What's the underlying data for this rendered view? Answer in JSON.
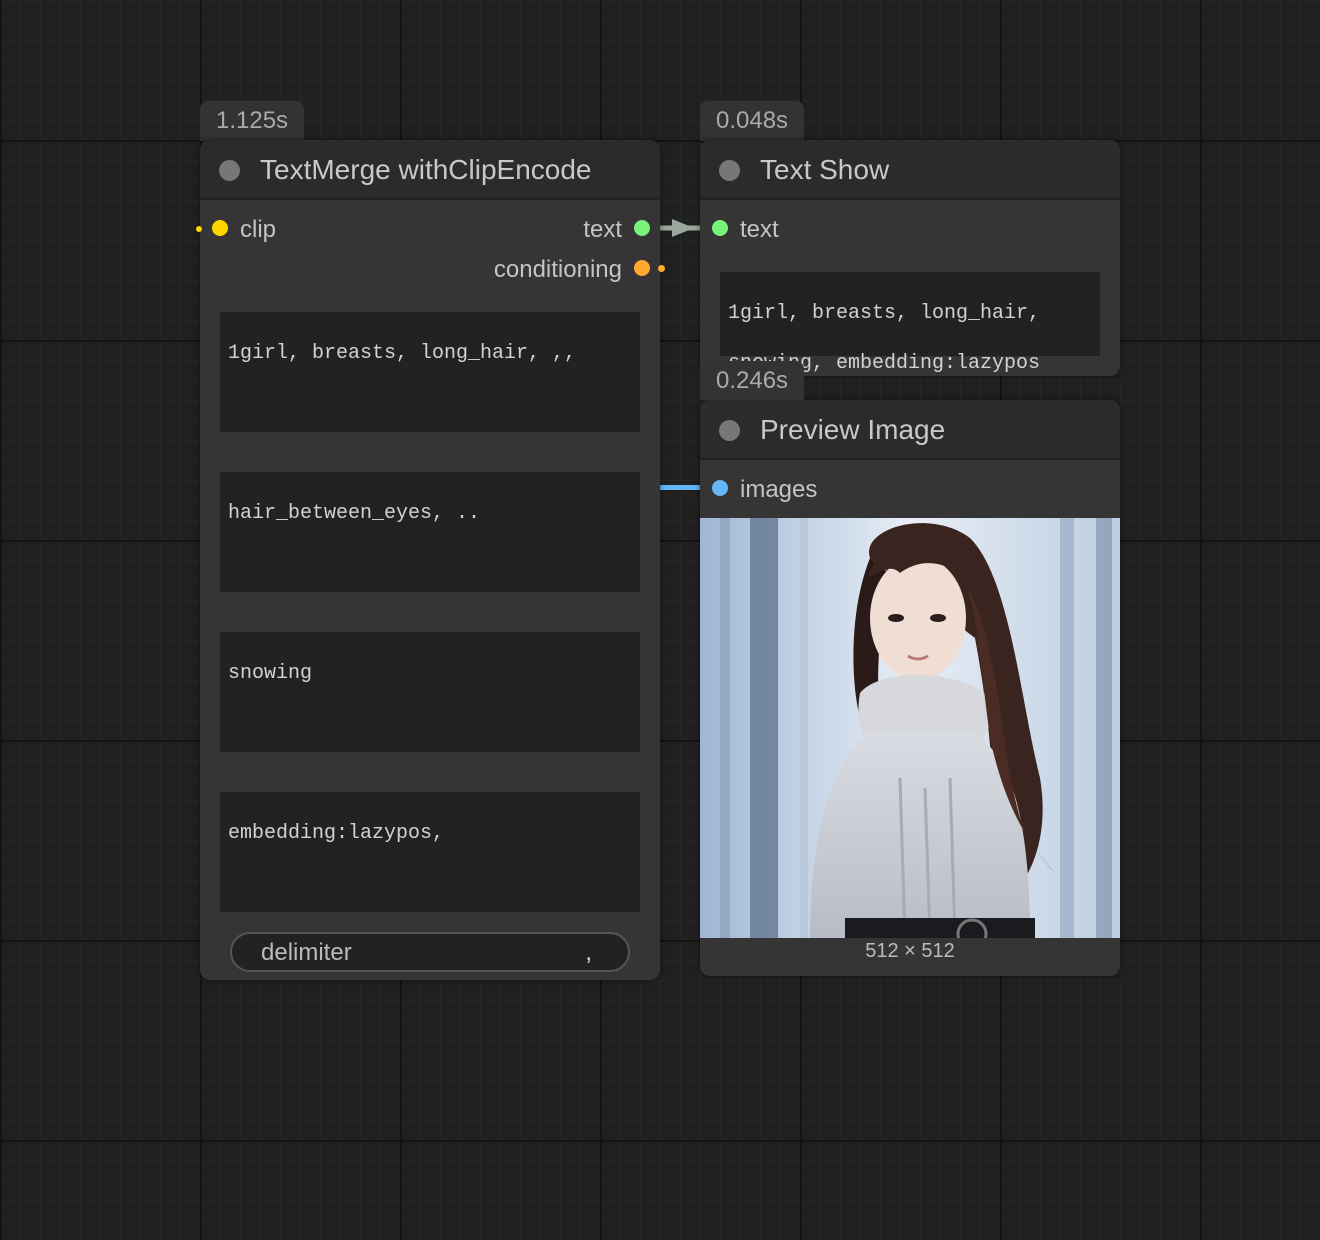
{
  "nodes": {
    "text_merge": {
      "timing": "1.125s",
      "title": "TextMerge withClipEncode",
      "inputs": [
        "clip"
      ],
      "outputs": [
        "text",
        "conditioning"
      ],
      "text_fields": [
        "1girl, breasts, long_hair, ,,",
        "hair_between_eyes, ..",
        "snowing",
        "embedding:lazypos,"
      ],
      "delimiter": {
        "name": "delimiter",
        "value": ","
      }
    },
    "text_show": {
      "timing": "0.048s",
      "title": "Text Show",
      "inputs": [
        "text"
      ],
      "display_text": "1girl, breasts, long_hair,",
      "overflow_text": "snowing, embedding:lazypos"
    },
    "preview_image": {
      "timing": "0.246s",
      "title": "Preview Image",
      "inputs": [
        "images"
      ],
      "image_size": "512 × 512"
    }
  },
  "colors": {
    "clip": "#ffd500",
    "text": "#7af27a",
    "conditioning": "#ffa931",
    "images": "#64b5f6",
    "text_link": "#9aa79a",
    "image_link": "#64b5f6"
  }
}
